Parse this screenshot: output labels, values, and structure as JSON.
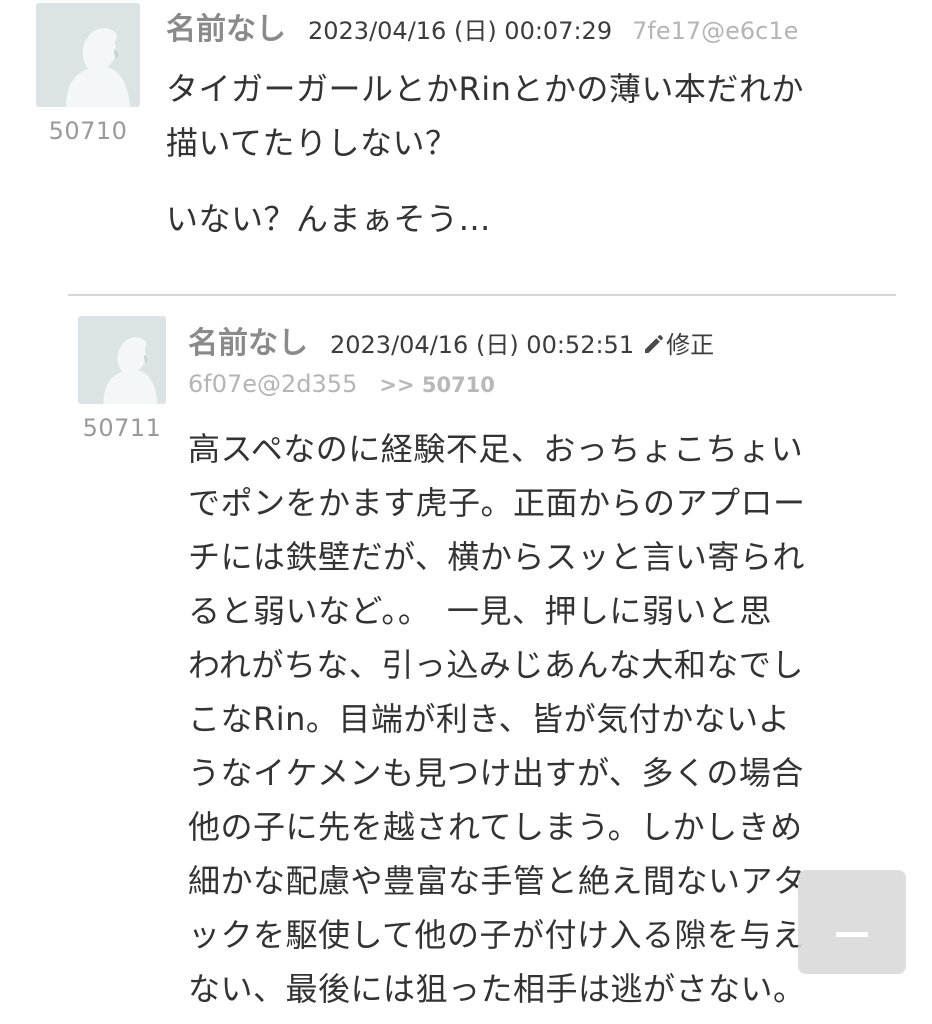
{
  "posts": [
    {
      "author": "名前なし",
      "date": "2023/04/16 (日) 00:07:29",
      "uid": "7fe17@e6c1e",
      "number": "50710",
      "lines": [
        "タイガーガールとかRinとかの薄い本だれか",
        "描いてたりしない？"
      ],
      "line2": "いない？んまぁそう…"
    },
    {
      "author": "名前なし",
      "date": "2023/04/16 (日) 00:52:51",
      "edit_label": "修正",
      "uid": "6f07e@2d355",
      "reply_to": ">> 50710",
      "number": "50711",
      "lines": [
        "高スペなのに経験不足、おっちょこちょい",
        "でポンをかます虎子。正面からのアプロー",
        "チには鉄壁だが、横からスッと言い寄られ",
        "ると弱いなど。。　一見、押しに弱いと思",
        "われがちな、引っ込みじあんな大和なでし",
        "こなRin。目端が利き、皆が気付かないよ",
        "うなイケメンも見つけ出すが、多くの場合",
        "他の子に先を越されてしまう。しかしきめ",
        "細かな配慮や豊富な手管と絶え間ないアタ",
        "ックを駆使して他の子が付け入る隙を与え",
        "ない、最後には狙った相手は逃がさない。"
      ]
    }
  ],
  "icons": {
    "avatar": "default-avatar-silhouette",
    "edit": "pencil-icon",
    "scroll_top": "scroll-to-top-icon"
  },
  "colors": {
    "avatar_bg": "#dbe3e4",
    "author": "#8a8a8a",
    "uid": "#b5b5b5",
    "divider": "#d6d6d6"
  }
}
